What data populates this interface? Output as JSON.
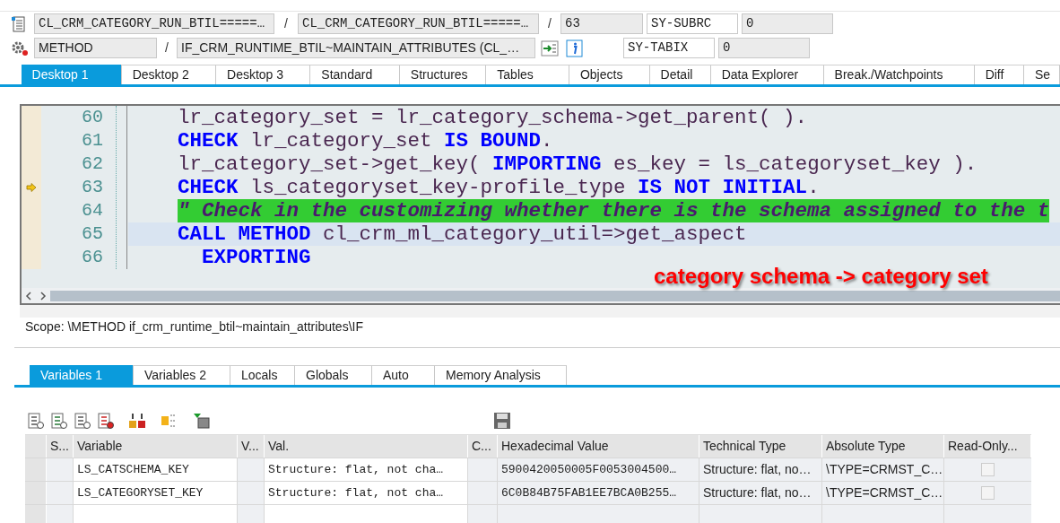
{
  "header": {
    "row1": {
      "fields": [
        "CL_CRM_CATEGORY_RUN_BTIL=====…",
        "CL_CRM_CATEGORY_RUN_BTIL=====…",
        "63"
      ],
      "separators": [
        "/",
        "/"
      ],
      "sys_label": "SY-SUBRC",
      "sys_value": "0"
    },
    "row2": {
      "fields": [
        "METHOD",
        "IF_CRM_RUNTIME_BTIL~MAINTAIN_ATTRIBUTES (CL_…"
      ],
      "separators": [
        "/"
      ],
      "sys_label": "SY-TABIX",
      "sys_value": "0"
    }
  },
  "desktop_tabs": [
    {
      "label": "Desktop 1",
      "selected": true
    },
    {
      "label": "Desktop 2",
      "selected": false
    },
    {
      "label": "Desktop 3",
      "selected": false
    },
    {
      "label": "Standard",
      "selected": false
    },
    {
      "label": "Structures",
      "selected": false
    },
    {
      "label": "Tables",
      "selected": false
    },
    {
      "label": "Objects",
      "selected": false
    },
    {
      "label": "Detail",
      "selected": false
    },
    {
      "label": "Data Explorer",
      "selected": false
    },
    {
      "label": "Break./Watchpoints",
      "selected": false
    },
    {
      "label": "Diff",
      "selected": false
    },
    {
      "label": "Se",
      "selected": false
    }
  ],
  "code": {
    "lines": [
      {
        "number": "60",
        "execution_point": false,
        "cursor_line": false,
        "tokens": [
          {
            "kind": "text",
            "text": "lr_category_set = lr_category_schema->get_parent( )."
          }
        ]
      },
      {
        "number": "61",
        "execution_point": false,
        "cursor_line": false,
        "tokens": [
          {
            "kind": "keyword",
            "text": "CHECK"
          },
          {
            "kind": "text",
            "text": " lr_category_set "
          },
          {
            "kind": "keyword",
            "text": "IS BOUND"
          },
          {
            "kind": "text",
            "text": "."
          }
        ]
      },
      {
        "number": "62",
        "execution_point": false,
        "cursor_line": false,
        "tokens": [
          {
            "kind": "text",
            "text": "lr_category_set->get_key( "
          },
          {
            "kind": "keyword",
            "text": "IMPORTING"
          },
          {
            "kind": "text",
            "text": " es_key = ls_categoryset_key )."
          }
        ]
      },
      {
        "number": "63",
        "execution_point": true,
        "cursor_line": false,
        "tokens": [
          {
            "kind": "keyword",
            "text": "CHECK"
          },
          {
            "kind": "text",
            "text": " ls_categoryset_key-profile_type "
          },
          {
            "kind": "keyword",
            "text": "IS NOT INITIAL"
          },
          {
            "kind": "text",
            "text": "."
          }
        ]
      },
      {
        "number": "64",
        "execution_point": false,
        "cursor_line": false,
        "tokens": [
          {
            "kind": "comment",
            "text": "\" Check in the customizing whether there is the schema assigned to the t"
          }
        ]
      },
      {
        "number": "65",
        "execution_point": false,
        "cursor_line": true,
        "tokens": [
          {
            "kind": "keyword",
            "text": "CALL METHOD"
          },
          {
            "kind": "text",
            "text": " cl_crm_ml_category_util=>get_aspect"
          }
        ]
      },
      {
        "number": "66",
        "execution_point": false,
        "cursor_line": false,
        "tokens": [
          {
            "kind": "keyword",
            "text": "  EXPORTING"
          }
        ]
      }
    ],
    "annotation": "category schema -> category set"
  },
  "scope": "Scope: \\METHOD if_crm_runtime_btil~maintain_attributes\\IF",
  "variable_tabs": [
    {
      "label": "Variables 1",
      "selected": true
    },
    {
      "label": "Variables 2",
      "selected": false
    },
    {
      "label": "Locals",
      "selected": false
    },
    {
      "label": "Globals",
      "selected": false
    },
    {
      "label": "Auto",
      "selected": false
    },
    {
      "label": "Memory Analysis",
      "selected": false
    }
  ],
  "table": {
    "columns": [
      "S...",
      "Variable",
      "V...",
      "Val.",
      "C...",
      "Hexadecimal Value",
      "Technical Type",
      "Absolute Type",
      "Read-Only..."
    ],
    "rows": [
      {
        "variable": "LS_CATSCHEMA_KEY",
        "value": "Structure: flat, not cha…",
        "hex": "5900420050005F0053004500…",
        "technical_type": "Structure: flat, no…",
        "absolute_type": "\\TYPE=CRMST_C…",
        "read_only": false
      },
      {
        "variable": "LS_CATEGORYSET_KEY",
        "value": "Structure: flat, not cha…",
        "hex": "6C0B84B75FAB1EE7BCA0B255…",
        "technical_type": "Structure: flat, no…",
        "absolute_type": "\\TYPE=CRMST_C…",
        "read_only": false
      }
    ]
  }
}
